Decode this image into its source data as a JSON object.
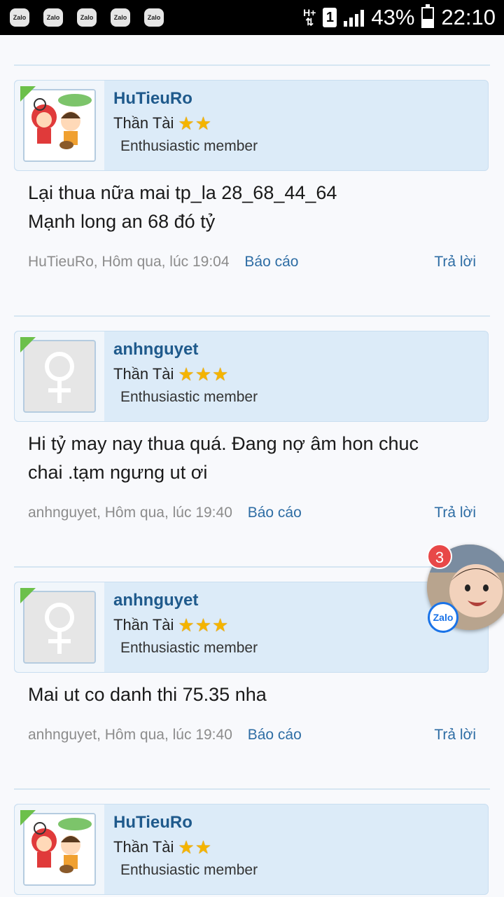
{
  "statusbar": {
    "notification_icons": [
      "Zalo",
      "Zalo",
      "Zalo",
      "Zalo",
      "Zalo"
    ],
    "network": "H+",
    "sim": "1",
    "battery": "43%",
    "battery_level": 0.43,
    "time": "22:10"
  },
  "posts": [
    {
      "username": "HuTieuRo",
      "rank": "Thần Tài",
      "stars": 2,
      "member_title": "Enthusiastic member",
      "avatar": "cartoon-avatar",
      "body_lines": [
        "Lại thua nữa mai tp_la 28_68_44_64",
        "Mạnh long an 68 đó tỷ"
      ],
      "meta": "HuTieuRo, Hôm qua, lúc 19:04",
      "report": "Báo cáo",
      "reply": "Trả lời"
    },
    {
      "username": "anhnguyet",
      "rank": "Thần Tài",
      "stars": 3,
      "member_title": "Enthusiastic member",
      "avatar": "female-placeholder-avatar",
      "body_lines": [
        "Hi tỷ may nay thua quá. Đang nợ âm hon chuc",
        "chai .tạm ngưng ut ơi"
      ],
      "meta": "anhnguyet, Hôm qua, lúc 19:40",
      "report": "Báo cáo",
      "reply": "Trả lời"
    },
    {
      "username": "anhnguyet",
      "rank": "Thần Tài",
      "stars": 3,
      "member_title": "Enthusiastic member",
      "avatar": "female-placeholder-avatar",
      "body_lines": [
        "Mai ut co danh thi 75.35 nha"
      ],
      "meta": "anhnguyet, Hôm qua, lúc 19:40",
      "report": "Báo cáo",
      "reply": "Trả lời"
    },
    {
      "username": "HuTieuRo",
      "rank": "Thần Tài",
      "stars": 2,
      "member_title": "Enthusiastic member",
      "avatar": "cartoon-avatar"
    }
  ],
  "chathead": {
    "badge_count": "3",
    "app_label": "Zalo"
  }
}
